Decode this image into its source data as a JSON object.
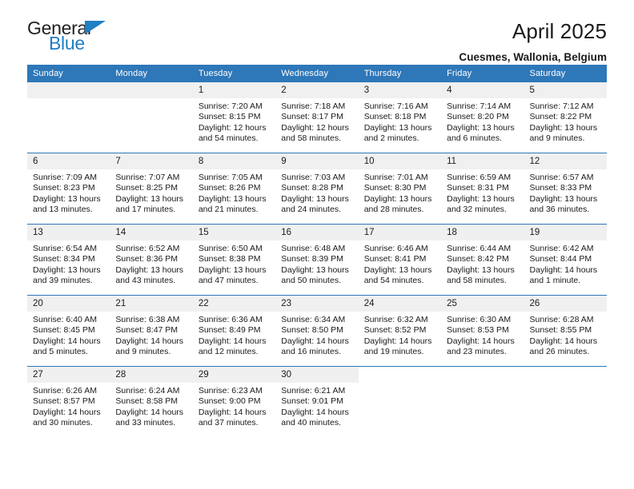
{
  "brand": {
    "name_top": "General",
    "name_bottom": "Blue",
    "accent_color": "#1f7ec4"
  },
  "header": {
    "title": "April 2025",
    "subtitle": "Cuesmes, Wallonia, Belgium"
  },
  "theme": {
    "header_blue": "#2e77b8",
    "daynum_band": "#f0f0f0",
    "text": "#1a1a1a"
  },
  "weekday_headers": [
    "Sunday",
    "Monday",
    "Tuesday",
    "Wednesday",
    "Thursday",
    "Friday",
    "Saturday"
  ],
  "labels": {
    "sunrise_prefix": "Sunrise:",
    "sunset_prefix": "Sunset:",
    "daylight_prefix": "Daylight:"
  },
  "weeks": [
    [
      {
        "day": "",
        "sunrise": "",
        "sunset": "",
        "daylight_line1": "",
        "daylight_line2": ""
      },
      {
        "day": "",
        "sunrise": "",
        "sunset": "",
        "daylight_line1": "",
        "daylight_line2": ""
      },
      {
        "day": "1",
        "sunrise": "Sunrise: 7:20 AM",
        "sunset": "Sunset: 8:15 PM",
        "daylight_line1": "Daylight: 12 hours",
        "daylight_line2": "and 54 minutes."
      },
      {
        "day": "2",
        "sunrise": "Sunrise: 7:18 AM",
        "sunset": "Sunset: 8:17 PM",
        "daylight_line1": "Daylight: 12 hours",
        "daylight_line2": "and 58 minutes."
      },
      {
        "day": "3",
        "sunrise": "Sunrise: 7:16 AM",
        "sunset": "Sunset: 8:18 PM",
        "daylight_line1": "Daylight: 13 hours",
        "daylight_line2": "and 2 minutes."
      },
      {
        "day": "4",
        "sunrise": "Sunrise: 7:14 AM",
        "sunset": "Sunset: 8:20 PM",
        "daylight_line1": "Daylight: 13 hours",
        "daylight_line2": "and 6 minutes."
      },
      {
        "day": "5",
        "sunrise": "Sunrise: 7:12 AM",
        "sunset": "Sunset: 8:22 PM",
        "daylight_line1": "Daylight: 13 hours",
        "daylight_line2": "and 9 minutes."
      }
    ],
    [
      {
        "day": "6",
        "sunrise": "Sunrise: 7:09 AM",
        "sunset": "Sunset: 8:23 PM",
        "daylight_line1": "Daylight: 13 hours",
        "daylight_line2": "and 13 minutes."
      },
      {
        "day": "7",
        "sunrise": "Sunrise: 7:07 AM",
        "sunset": "Sunset: 8:25 PM",
        "daylight_line1": "Daylight: 13 hours",
        "daylight_line2": "and 17 minutes."
      },
      {
        "day": "8",
        "sunrise": "Sunrise: 7:05 AM",
        "sunset": "Sunset: 8:26 PM",
        "daylight_line1": "Daylight: 13 hours",
        "daylight_line2": "and 21 minutes."
      },
      {
        "day": "9",
        "sunrise": "Sunrise: 7:03 AM",
        "sunset": "Sunset: 8:28 PM",
        "daylight_line1": "Daylight: 13 hours",
        "daylight_line2": "and 24 minutes."
      },
      {
        "day": "10",
        "sunrise": "Sunrise: 7:01 AM",
        "sunset": "Sunset: 8:30 PM",
        "daylight_line1": "Daylight: 13 hours",
        "daylight_line2": "and 28 minutes."
      },
      {
        "day": "11",
        "sunrise": "Sunrise: 6:59 AM",
        "sunset": "Sunset: 8:31 PM",
        "daylight_line1": "Daylight: 13 hours",
        "daylight_line2": "and 32 minutes."
      },
      {
        "day": "12",
        "sunrise": "Sunrise: 6:57 AM",
        "sunset": "Sunset: 8:33 PM",
        "daylight_line1": "Daylight: 13 hours",
        "daylight_line2": "and 36 minutes."
      }
    ],
    [
      {
        "day": "13",
        "sunrise": "Sunrise: 6:54 AM",
        "sunset": "Sunset: 8:34 PM",
        "daylight_line1": "Daylight: 13 hours",
        "daylight_line2": "and 39 minutes."
      },
      {
        "day": "14",
        "sunrise": "Sunrise: 6:52 AM",
        "sunset": "Sunset: 8:36 PM",
        "daylight_line1": "Daylight: 13 hours",
        "daylight_line2": "and 43 minutes."
      },
      {
        "day": "15",
        "sunrise": "Sunrise: 6:50 AM",
        "sunset": "Sunset: 8:38 PM",
        "daylight_line1": "Daylight: 13 hours",
        "daylight_line2": "and 47 minutes."
      },
      {
        "day": "16",
        "sunrise": "Sunrise: 6:48 AM",
        "sunset": "Sunset: 8:39 PM",
        "daylight_line1": "Daylight: 13 hours",
        "daylight_line2": "and 50 minutes."
      },
      {
        "day": "17",
        "sunrise": "Sunrise: 6:46 AM",
        "sunset": "Sunset: 8:41 PM",
        "daylight_line1": "Daylight: 13 hours",
        "daylight_line2": "and 54 minutes."
      },
      {
        "day": "18",
        "sunrise": "Sunrise: 6:44 AM",
        "sunset": "Sunset: 8:42 PM",
        "daylight_line1": "Daylight: 13 hours",
        "daylight_line2": "and 58 minutes."
      },
      {
        "day": "19",
        "sunrise": "Sunrise: 6:42 AM",
        "sunset": "Sunset: 8:44 PM",
        "daylight_line1": "Daylight: 14 hours",
        "daylight_line2": "and 1 minute."
      }
    ],
    [
      {
        "day": "20",
        "sunrise": "Sunrise: 6:40 AM",
        "sunset": "Sunset: 8:45 PM",
        "daylight_line1": "Daylight: 14 hours",
        "daylight_line2": "and 5 minutes."
      },
      {
        "day": "21",
        "sunrise": "Sunrise: 6:38 AM",
        "sunset": "Sunset: 8:47 PM",
        "daylight_line1": "Daylight: 14 hours",
        "daylight_line2": "and 9 minutes."
      },
      {
        "day": "22",
        "sunrise": "Sunrise: 6:36 AM",
        "sunset": "Sunset: 8:49 PM",
        "daylight_line1": "Daylight: 14 hours",
        "daylight_line2": "and 12 minutes."
      },
      {
        "day": "23",
        "sunrise": "Sunrise: 6:34 AM",
        "sunset": "Sunset: 8:50 PM",
        "daylight_line1": "Daylight: 14 hours",
        "daylight_line2": "and 16 minutes."
      },
      {
        "day": "24",
        "sunrise": "Sunrise: 6:32 AM",
        "sunset": "Sunset: 8:52 PM",
        "daylight_line1": "Daylight: 14 hours",
        "daylight_line2": "and 19 minutes."
      },
      {
        "day": "25",
        "sunrise": "Sunrise: 6:30 AM",
        "sunset": "Sunset: 8:53 PM",
        "daylight_line1": "Daylight: 14 hours",
        "daylight_line2": "and 23 minutes."
      },
      {
        "day": "26",
        "sunrise": "Sunrise: 6:28 AM",
        "sunset": "Sunset: 8:55 PM",
        "daylight_line1": "Daylight: 14 hours",
        "daylight_line2": "and 26 minutes."
      }
    ],
    [
      {
        "day": "27",
        "sunrise": "Sunrise: 6:26 AM",
        "sunset": "Sunset: 8:57 PM",
        "daylight_line1": "Daylight: 14 hours",
        "daylight_line2": "and 30 minutes."
      },
      {
        "day": "28",
        "sunrise": "Sunrise: 6:24 AM",
        "sunset": "Sunset: 8:58 PM",
        "daylight_line1": "Daylight: 14 hours",
        "daylight_line2": "and 33 minutes."
      },
      {
        "day": "29",
        "sunrise": "Sunrise: 6:23 AM",
        "sunset": "Sunset: 9:00 PM",
        "daylight_line1": "Daylight: 14 hours",
        "daylight_line2": "and 37 minutes."
      },
      {
        "day": "30",
        "sunrise": "Sunrise: 6:21 AM",
        "sunset": "Sunset: 9:01 PM",
        "daylight_line1": "Daylight: 14 hours",
        "daylight_line2": "and 40 minutes."
      },
      {
        "day": "",
        "sunrise": "",
        "sunset": "",
        "daylight_line1": "",
        "daylight_line2": ""
      },
      {
        "day": "",
        "sunrise": "",
        "sunset": "",
        "daylight_line1": "",
        "daylight_line2": ""
      },
      {
        "day": "",
        "sunrise": "",
        "sunset": "",
        "daylight_line1": "",
        "daylight_line2": ""
      }
    ]
  ]
}
